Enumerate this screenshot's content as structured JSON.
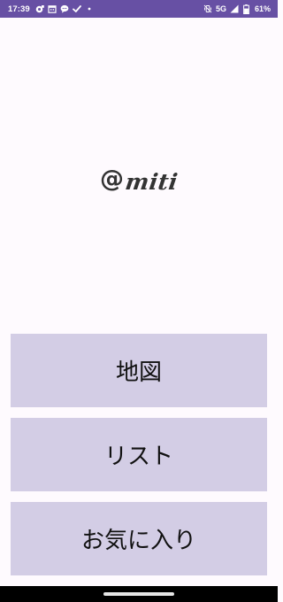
{
  "status_bar": {
    "time": "17:39",
    "network": "5G",
    "battery": "61%",
    "background": "#6750a4",
    "left_icons": [
      "camera-badge-icon",
      "calendar-icon",
      "chat-bubble-icon",
      "check-icon",
      "dot-icon"
    ],
    "right_icons": [
      "vibrate-off-icon",
      "signal-icon",
      "battery-icon"
    ]
  },
  "logo": {
    "at": "@",
    "text": "miti"
  },
  "menu": {
    "map_label": "地図",
    "list_label": "リスト",
    "favorites_label": "お気に入り",
    "button_color": "#d3cde5"
  },
  "theme": {
    "background": "#fefafe"
  }
}
